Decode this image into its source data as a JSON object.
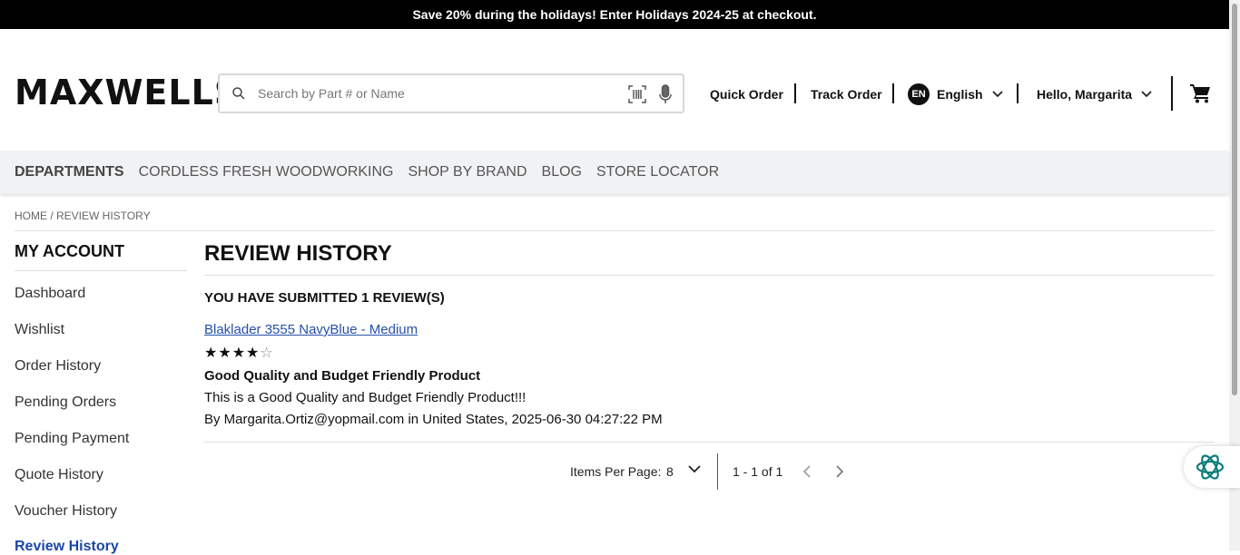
{
  "promo": {
    "text": "Save 20% during the holidays! Enter Holidays 2024-25 at checkout."
  },
  "header": {
    "logo": "MAXWELLS",
    "search_placeholder": "Search by Part # or Name",
    "quick_order": "Quick Order",
    "track_order": "Track Order",
    "language_code": "EN",
    "language": "English",
    "greeting": "Hello, Margarita"
  },
  "categories": {
    "departments": "DEPARTMENTS",
    "items": [
      "CORDLESS FRESH WOODWORKING",
      "SHOP BY BRAND",
      "BLOG",
      "STORE LOCATOR"
    ]
  },
  "breadcrumb": "HOME / REVIEW HISTORY",
  "sidebar": {
    "title": "MY ACCOUNT",
    "items": [
      "Dashboard",
      "Wishlist",
      "Order History",
      "Pending Orders",
      "Pending Payment",
      "Quote History",
      "Voucher History",
      "Review History"
    ],
    "active": "Review History"
  },
  "main": {
    "title": "REVIEW HISTORY",
    "summary": "YOU HAVE SUBMITTED 1 REVIEW(S)",
    "review": {
      "product": "Blaklader 3555 NavyBlue - Medium",
      "rating": 4,
      "rating_max": 5,
      "title": "Good Quality and Budget Friendly Product",
      "body": "This is a Good Quality and Budget Friendly Product!!!",
      "byline": "By Margarita.Ortiz@yopmail.com in United States, 2025-06-30 04:27:22 PM"
    }
  },
  "pager": {
    "label": "Items Per Page:",
    "per_page": "8",
    "count": "1 - 1 of 1"
  },
  "icons": {
    "search": "search-icon",
    "barcode": "barcode-icon",
    "mic": "microphone-icon",
    "cart": "cart-icon",
    "chat": "chat-assistant-icon"
  }
}
